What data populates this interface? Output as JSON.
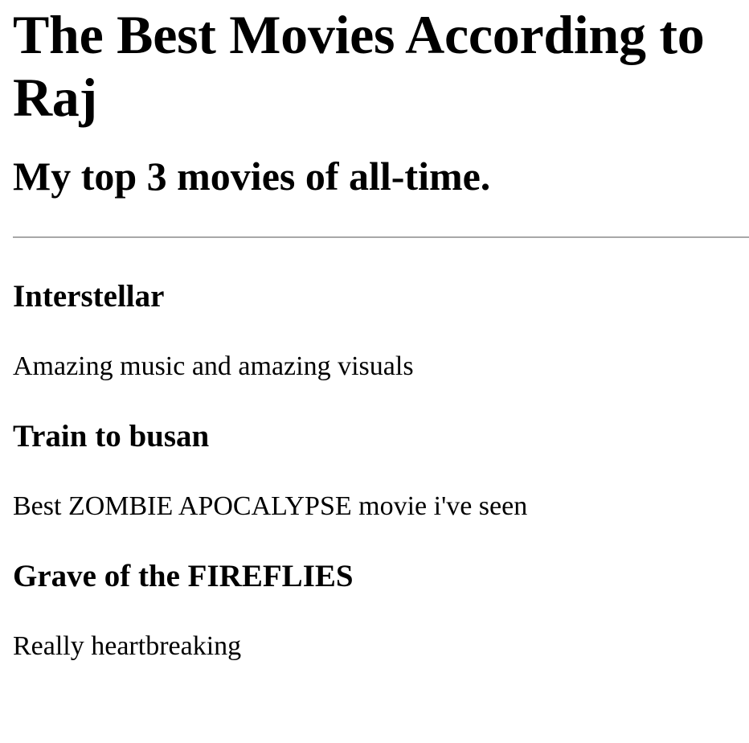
{
  "page": {
    "title": "The Best Movies According to Raj",
    "subtitle": "My top 3 movies of all-time."
  },
  "movies": [
    {
      "title": "Interstellar",
      "review": "Amazing music and amazing visuals"
    },
    {
      "title": "Train to busan",
      "review": "Best ZOMBIE APOCALYPSE movie i've seen"
    },
    {
      "title": "Grave of the FIREFLIES",
      "review": "Really heartbreaking"
    }
  ]
}
